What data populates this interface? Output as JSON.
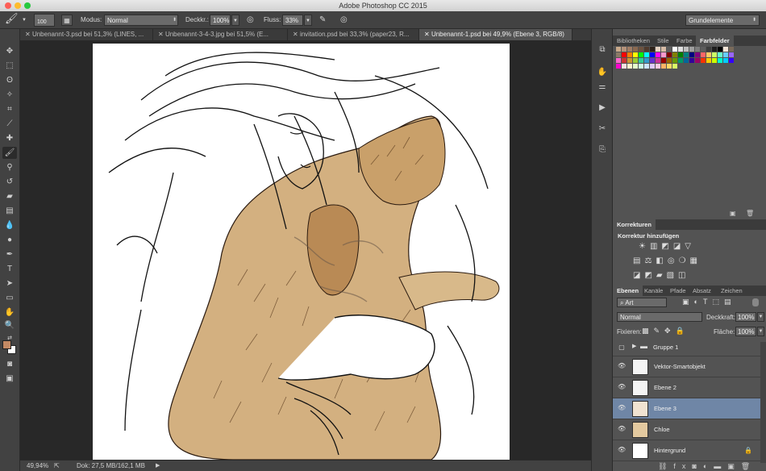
{
  "app": {
    "title": "Adobe Photoshop CC 2015"
  },
  "options_bar": {
    "brush_size": "100",
    "mode_label": "Modus:",
    "mode_value": "Normal",
    "opacity_label": "Deckkr.:",
    "opacity_value": "100%",
    "flow_label": "Fluss:",
    "flow_value": "33%",
    "workspace": "Grundelemente"
  },
  "tabs": [
    {
      "label": "Unbenannt-3.psd bei 51,3% (LINES, ..."
    },
    {
      "label": "Unbenannt-3-4-3.jpg bei 51,5% (E..."
    },
    {
      "label": "invitation.psd bei 33,3% (paper23, R..."
    },
    {
      "label": "Unbenannt-1.psd bei 49,9% (Ebene 3, RGB/8)"
    }
  ],
  "status": {
    "zoom": "49,94%",
    "doc": "Dok: 27,5 MB/162,1 MB"
  },
  "swatches_panel": {
    "tabs": [
      "Bibliotheken",
      "Stile",
      "Farbe",
      "Farbfelder"
    ],
    "active": "Farbfelder",
    "colors": [
      "#c9a98a",
      "#b5927a",
      "#a07c64",
      "#8a6850",
      "#6e533f",
      "#4f3a2c",
      "#2e2219",
      "#e6d2c2",
      "#d7bca6",
      "#5c5c5c",
      "#ffffff",
      "#e0e0e0",
      "#bfbfbf",
      "#9e9e9e",
      "#7d7d7d",
      "#5d5d5d",
      "#3d3d3d",
      "#1e1e1e",
      "#000000",
      "#f5e6d8",
      "#7a6a5a",
      "#8a7a66",
      "#ff0000",
      "#ff7f00",
      "#ffff00",
      "#00ff00",
      "#00ffff",
      "#0000ff",
      "#ff00ff",
      "#ff99cc",
      "#800000",
      "#808000",
      "#008000",
      "#008080",
      "#000080",
      "#800080",
      "#ff6666",
      "#ffcc66",
      "#ccff66",
      "#66ffcc",
      "#66ccff",
      "#9966ff",
      "#ff66cc",
      "#cc3333",
      "#cc9933",
      "#99cc33",
      "#33cc99",
      "#3399cc",
      "#6633cc",
      "#cc3399",
      "#990000",
      "#996600",
      "#669900",
      "#009966",
      "#006699",
      "#330099",
      "#990066",
      "#ff3300",
      "#ffcc00",
      "#ccff00",
      "#00ffcc",
      "#00ccff",
      "#3300ff",
      "#ff00cc",
      "#ffe0e0",
      "#fff2cc",
      "#e5ffcc",
      "#ccffe5",
      "#cce5ff",
      "#e0ccff",
      "#ffcce5",
      "#ffb366",
      "#ffd966",
      "#d9ff66"
    ]
  },
  "corrections_panel": {
    "title": "Korrekturen",
    "subtitle": "Korrektur hinzufügen"
  },
  "layers_panel": {
    "tabs": [
      "Ebenen",
      "Kanäle",
      "Pfade",
      "Absatz",
      "Zeichen"
    ],
    "active": "Ebenen",
    "filter": "Art",
    "blend_mode": "Normal",
    "opacity_label": "Deckkraft:",
    "opacity_value": "100%",
    "lock_label": "Fixieren:",
    "fill_label": "Fläche:",
    "fill_value": "100%",
    "layers": [
      {
        "name": "Gruppe 1",
        "type": "group",
        "visible": false
      },
      {
        "name": "Vektor-Smartobjekt",
        "type": "smart",
        "visible": true
      },
      {
        "name": "Ebene 2",
        "type": "pixel",
        "visible": true
      },
      {
        "name": "Ebene 3",
        "type": "pixel",
        "visible": true,
        "selected": true
      },
      {
        "name": "Chloe",
        "type": "pixel",
        "visible": true
      },
      {
        "name": "Hintergrund",
        "type": "background",
        "visible": true,
        "locked": true
      }
    ]
  },
  "colors": {
    "foreground": "#c48a64",
    "background": "#ffffff",
    "selected_layer": "#6f86a6"
  }
}
